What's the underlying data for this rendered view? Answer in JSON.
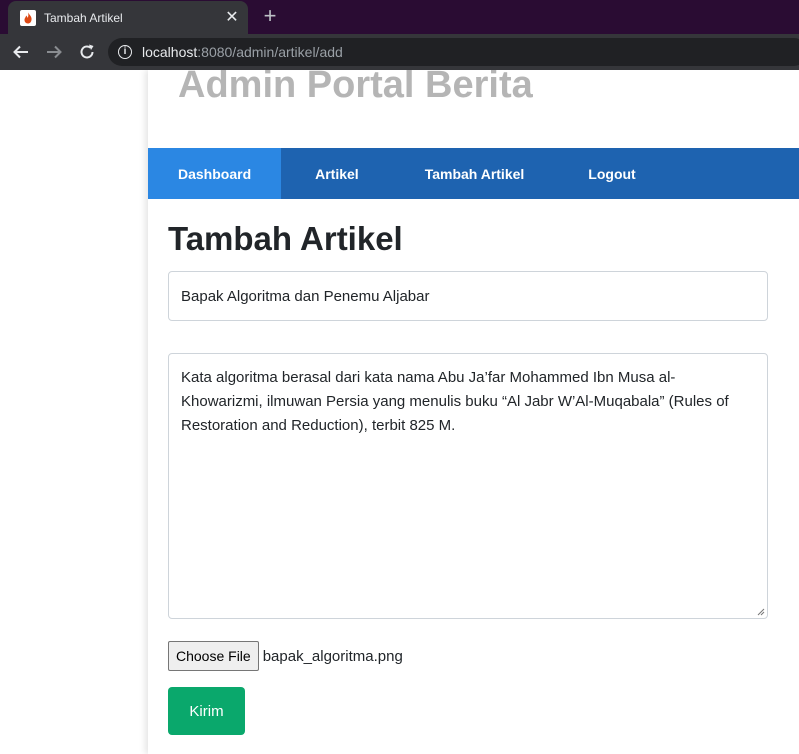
{
  "browser": {
    "tab_title": "Tambah Artikel",
    "new_tab_symbol": "+",
    "close_symbol": "✕",
    "url_host": "localhost",
    "url_rest": ":8080/admin/artikel/add",
    "info_symbol": "i"
  },
  "site": {
    "title": "Admin Portal Berita"
  },
  "nav": {
    "items": [
      {
        "label": "Dashboard",
        "active": true
      },
      {
        "label": "Artikel",
        "active": false
      },
      {
        "label": "Tambah Artikel",
        "active": false
      },
      {
        "label": "Logout",
        "active": false
      }
    ]
  },
  "form": {
    "heading": "Tambah Artikel",
    "title_value": "Bapak Algoritma dan Penemu Aljabar",
    "content_value": "Kata algoritma berasal dari kata nama Abu Ja’far Mohammed Ibn Musa al-Khowarizmi, ilmuwan Persia yang menulis buku “Al Jabr W’Al-Muqabala” (Rules of Restoration and Reduction), terbit 825 M.",
    "file_button_label": "Choose File",
    "file_name": "bapak_algoritma.png",
    "submit_label": "Kirim"
  },
  "colors": {
    "tabstrip": "#2a0c33",
    "toolbar": "#35363a",
    "navbar": "#1e63b0",
    "nav_active": "#2b87e3",
    "submit": "#0aa86c",
    "site_title": "#b5b5b5"
  },
  "icons": {
    "favicon": "flame-icon",
    "back": "arrow-left-icon",
    "forward": "arrow-right-icon",
    "reload": "reload-icon",
    "info": "info-icon"
  }
}
